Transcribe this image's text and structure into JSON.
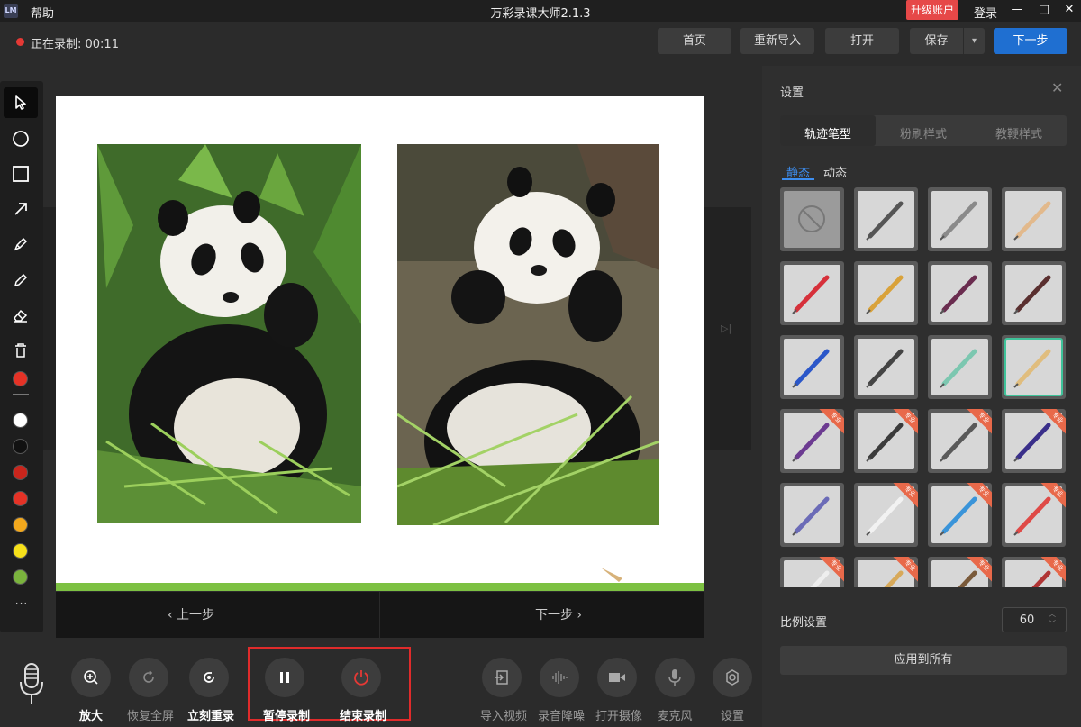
{
  "titlebar": {
    "logo": "LM",
    "menu_help": "帮助",
    "title": "万彩录课大师2.1.3",
    "upgrade": "升级账户",
    "login": "登录",
    "minimize": "—",
    "maximize": "□",
    "close": "✕"
  },
  "recording": {
    "status": "正在录制: 00:11"
  },
  "top_buttons": {
    "home": "首页",
    "reimport": "重新导入",
    "open": "打开",
    "save": "保存",
    "next": "下一步"
  },
  "toolbar": {
    "colors": [
      "#e53226",
      "#ffffff",
      "#111111",
      "#c9251c",
      "#e53226",
      "#f2a81d",
      "#f7e11a",
      "#7ab33d"
    ],
    "more": "···"
  },
  "canvas_nav": {
    "prev": "上一步",
    "next": "下一步"
  },
  "bottom": {
    "zoom_in": "放大",
    "restore_fullscreen": "恢复全屏",
    "rerecord": "立刻重录",
    "pause_record": "暂停录制",
    "end_record": "结束录制",
    "import_video": "导入视频",
    "noise_reduction": "录音降噪",
    "open_camera": "打开摄像",
    "microphone": "麦克风",
    "settings": "设置"
  },
  "panel": {
    "title": "设置",
    "tabs": [
      "轨迹笔型",
      "粉刷样式",
      "教鞭样式"
    ],
    "subtabs": [
      "静态",
      "动态"
    ],
    "pro_badge": "专业",
    "pens": [
      {
        "color": "none",
        "pro": false
      },
      {
        "color": "#555555",
        "pro": false
      },
      {
        "color": "#8a8a8a",
        "pro": false
      },
      {
        "color": "#e2b98c",
        "pro": false
      },
      {
        "color": "#d6303a",
        "pro": false
      },
      {
        "color": "#d9a23a",
        "pro": false
      },
      {
        "color": "#6a2c4f",
        "pro": false
      },
      {
        "color": "#5a2f2f",
        "pro": false
      },
      {
        "color": "#2b57c9",
        "pro": false
      },
      {
        "color": "#444444",
        "pro": false
      },
      {
        "color": "#7cc7b0",
        "pro": false
      },
      {
        "color": "#e0bd7e",
        "pro": false,
        "selected": true
      },
      {
        "color": "#6c3b91",
        "pro": true
      },
      {
        "color": "#3b3b3b",
        "pro": true
      },
      {
        "color": "#5a5a5a",
        "pro": true
      },
      {
        "color": "#3a2f8a",
        "pro": true
      },
      {
        "color": "#6b6bb7",
        "pro": false
      },
      {
        "color": "#f2f2f2",
        "pro": true
      },
      {
        "color": "#3a94d9",
        "pro": true
      },
      {
        "color": "#df4a47",
        "pro": true
      },
      {
        "color": "#eeeeee",
        "pro": true
      },
      {
        "color": "#d7a95a",
        "pro": true
      },
      {
        "color": "#7a5a3a",
        "pro": true
      },
      {
        "color": "#b03535",
        "pro": true
      }
    ],
    "scale_label": "比例设置",
    "scale_value": "60",
    "apply_all": "应用到所有"
  }
}
